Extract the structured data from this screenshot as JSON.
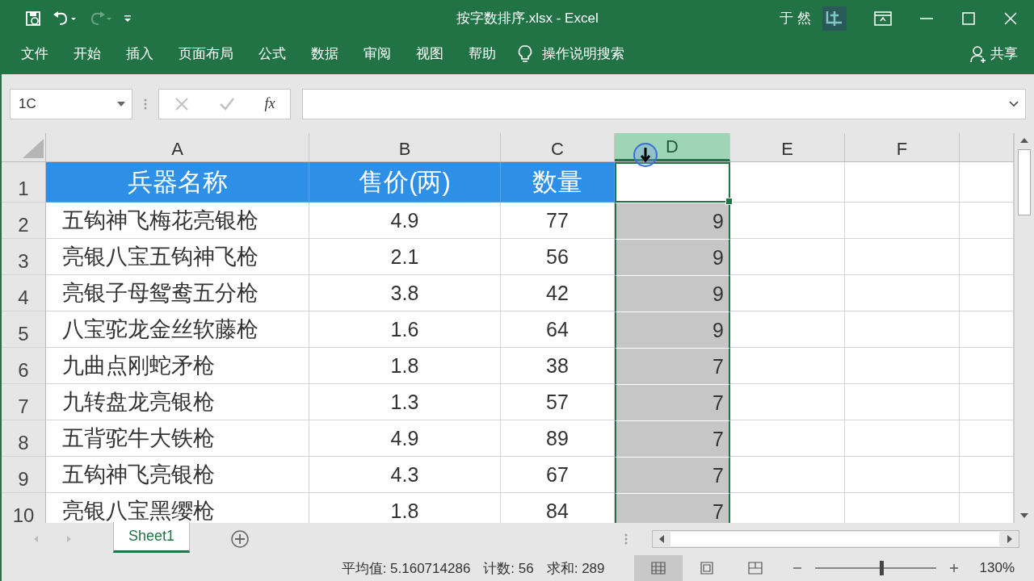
{
  "title_bar": {
    "file_title": "按字数排序.xlsx  -  Excel",
    "user": "于 然"
  },
  "ribbon_tabs": [
    {
      "label": "文件"
    },
    {
      "label": "开始"
    },
    {
      "label": "插入"
    },
    {
      "label": "页面布局"
    },
    {
      "label": "公式"
    },
    {
      "label": "数据"
    },
    {
      "label": "审阅"
    },
    {
      "label": "视图"
    },
    {
      "label": "帮助"
    }
  ],
  "tell_me": "操作说明搜索",
  "share": "共享",
  "formula_bar": {
    "name_box": "1C",
    "fx": "fx"
  },
  "columns": [
    {
      "label": "A",
      "selected": false
    },
    {
      "label": "B",
      "selected": false
    },
    {
      "label": "C",
      "selected": false
    },
    {
      "label": "D",
      "selected": true
    },
    {
      "label": "E",
      "selected": false
    },
    {
      "label": "F",
      "selected": false
    }
  ],
  "rows": [
    {
      "number": "1",
      "kind": "header",
      "cells": [
        "兵器名称",
        "售价(两)",
        "数量",
        ""
      ]
    },
    {
      "number": "2",
      "kind": "data",
      "cells": [
        "五钩神飞梅花亮银枪",
        "4.9",
        "77",
        "9"
      ]
    },
    {
      "number": "3",
      "kind": "data",
      "cells": [
        "亮银八宝五钩神飞枪",
        "2.1",
        "56",
        "9"
      ]
    },
    {
      "number": "4",
      "kind": "data",
      "cells": [
        "亮银子母鸳鸯五分枪",
        "3.8",
        "42",
        "9"
      ]
    },
    {
      "number": "5",
      "kind": "data",
      "cells": [
        "八宝驼龙金丝软藤枪",
        "1.6",
        "64",
        "9"
      ]
    },
    {
      "number": "6",
      "kind": "data",
      "cells": [
        "九曲点刚蛇矛枪",
        "1.8",
        "38",
        "7"
      ]
    },
    {
      "number": "7",
      "kind": "data",
      "cells": [
        "九转盘龙亮银枪",
        "1.3",
        "57",
        "7"
      ]
    },
    {
      "number": "8",
      "kind": "data",
      "cells": [
        "五背驼牛大铁枪",
        "4.9",
        "89",
        "7"
      ]
    },
    {
      "number": "9",
      "kind": "data",
      "cells": [
        "五钩神飞亮银枪",
        "4.3",
        "67",
        "7"
      ]
    },
    {
      "number": "10",
      "kind": "data",
      "cells": [
        "亮银八宝黑缨枪",
        "1.8",
        "84",
        "7"
      ]
    }
  ],
  "sheets": [
    {
      "label": "Sheet1",
      "selected": true
    }
  ],
  "status_bar": {
    "average": "平均值: 5.160714286",
    "count": "计数: 56",
    "sum": "求和: 289",
    "views": [
      {
        "kind": "normal",
        "selected": true
      },
      {
        "kind": "page_layout",
        "selected": false
      },
      {
        "kind": "page_break",
        "selected": false
      }
    ],
    "zoom": {
      "level": 0.55
    },
    "zoom_text": "130%"
  }
}
